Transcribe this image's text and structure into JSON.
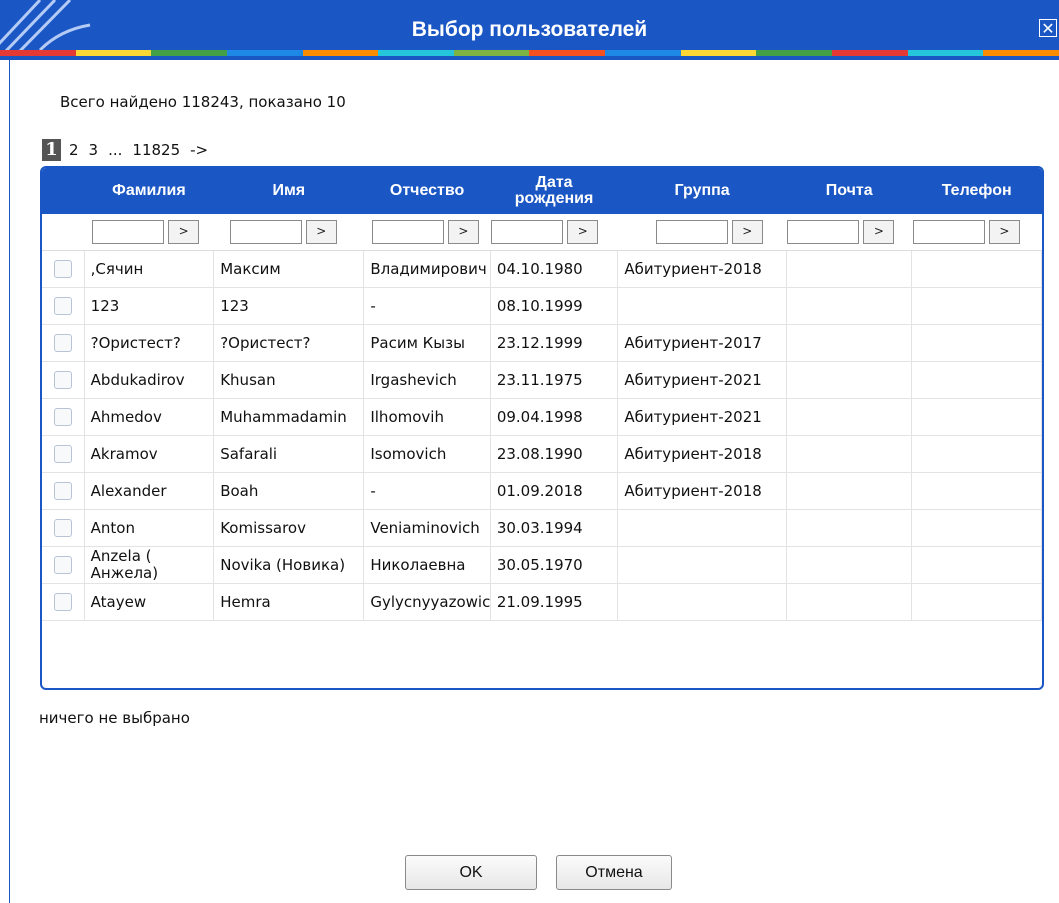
{
  "window": {
    "title": "Выбор пользователей",
    "close_glyph": "✕"
  },
  "colors": {
    "brand": "#1a56c4",
    "stripe": [
      "#e53935",
      "#fdd835",
      "#43a047",
      "#1e88e5",
      "#fb8c00",
      "#26c6da",
      "#7cb342",
      "#f4511e",
      "#1e88e5",
      "#fdd835",
      "#43a047",
      "#e53935",
      "#26c6da",
      "#fb8c00"
    ]
  },
  "summary": "Всего найдено 118243, показано 10",
  "pager": {
    "current": "1",
    "pages": [
      "2",
      "3"
    ],
    "ellipsis": "...",
    "last": "11825",
    "next": "->"
  },
  "table": {
    "columns": [
      "Фамилия",
      "Имя",
      "Отчество",
      "Дата рождения",
      "Группа",
      "Почта",
      "Телефон"
    ],
    "filter_button": ">",
    "rows": [
      [
        ",Сячин",
        "Максим",
        "Владимирович",
        "04.10.1980",
        "Абитуриент-2018",
        "",
        ""
      ],
      [
        "123",
        "123",
        "-",
        "08.10.1999",
        "",
        "",
        ""
      ],
      [
        "?Ористест?",
        "?Ористест?",
        "Расим Кызы",
        "23.12.1999",
        "Абитуриент-2017",
        "",
        ""
      ],
      [
        "Abdukadirov",
        "Khusan",
        "Irgashevich",
        "23.11.1975",
        "Абитуриент-2021",
        "",
        ""
      ],
      [
        "Ahmedov",
        "Muhammadamin",
        "Ilhomovih",
        "09.04.1998",
        "Абитуриент-2021",
        "",
        ""
      ],
      [
        "Akramov",
        "Safarali",
        "Isomovich",
        "23.08.1990",
        "Абитуриент-2018",
        "",
        ""
      ],
      [
        "Alexander",
        "Boah",
        "-",
        "01.09.2018",
        "Абитуриент-2018",
        "",
        ""
      ],
      [
        "Anton",
        "Komissarov",
        "Veniaminovich",
        "30.03.1994",
        "",
        "",
        ""
      ],
      [
        "Anzela ( Анжела)",
        "Novika (Новика)",
        "Николаевна",
        "30.05.1970",
        "",
        "",
        ""
      ],
      [
        "Atayew",
        "Hemra",
        "Gylycnyyazowic",
        "21.09.1995",
        "",
        "",
        ""
      ]
    ]
  },
  "selection_text": "ничего не выбрано",
  "buttons": {
    "ok": "OK",
    "cancel": "Отмена"
  }
}
